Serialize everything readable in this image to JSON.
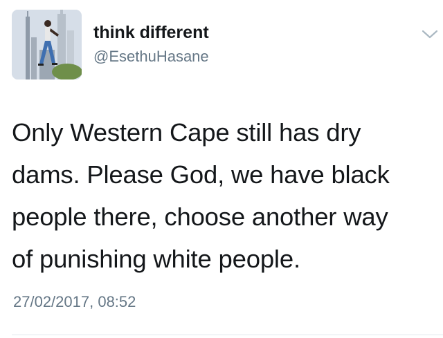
{
  "user": {
    "display_name": "think different",
    "handle": "@EsethuHasane",
    "avatar_icon": "profile-photo"
  },
  "tweet": {
    "lines": [
      "Only Western Cape still has dry",
      "dams. Please God, we have black",
      "people there, choose another way",
      "of punishing white people."
    ],
    "timestamp": "27/02/2017, 08:52"
  },
  "menu": {
    "icon": "chevron-down-icon"
  },
  "colors": {
    "text": "#14171a",
    "secondary": "#657786",
    "divider": "#e1e8ed"
  }
}
